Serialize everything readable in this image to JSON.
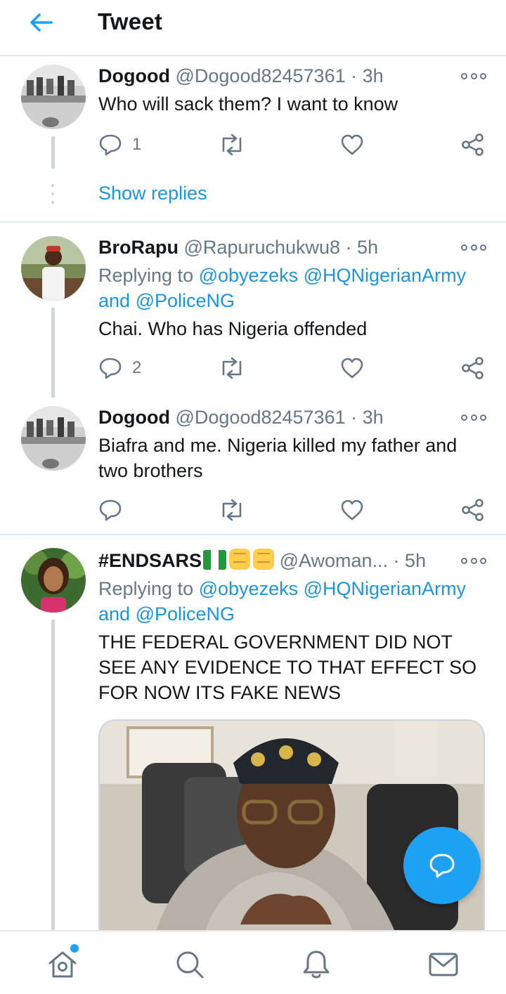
{
  "header": {
    "title": "Tweet",
    "back_icon": "arrow-left-icon"
  },
  "colors": {
    "accent": "#1da1f2",
    "link": "#1b95e0",
    "muted": "#657786",
    "divider": "#e1e8ed"
  },
  "tweets": [
    {
      "name": "Dogood",
      "handle": "@Dogood82457361",
      "time": "· 3h",
      "text": "Who will sack them? I want to know",
      "reply_count": "1"
    },
    {
      "name": "BroRapu",
      "handle": "@Rapuruchukwu8",
      "time": "· 5h",
      "replying_label": "Replying to",
      "mentions": [
        "@obyezeks",
        "@HQNigerianArmy",
        "@PoliceNG"
      ],
      "and_label": "and",
      "text": "Chai. Who has Nigeria offended",
      "reply_count": "2"
    },
    {
      "name": "Dogood",
      "handle": "@Dogood82457361",
      "time": "· 3h",
      "text": "Biafra and me. Nigeria killed my father and two brothers",
      "reply_count": ""
    },
    {
      "name": "#ENDSARS",
      "name_emoji": [
        "nigeria-flag",
        "raised-fist",
        "raised-fist"
      ],
      "handle": "@Awoman...",
      "time": "· 5h",
      "replying_label": "Replying to",
      "mentions": [
        "@obyezeks",
        "@HQNigerianArmy",
        "@PoliceNG"
      ],
      "and_label": "and",
      "text": "THE FEDERAL GOVERNMENT DID NOT SEE ANY EVIDENCE TO THAT EFFECT SO FOR NOW ITS FAKE NEWS"
    }
  ],
  "show_replies": "Show replies",
  "bottom_nav": [
    "home-icon",
    "search-icon",
    "notifications-icon",
    "messages-icon"
  ]
}
